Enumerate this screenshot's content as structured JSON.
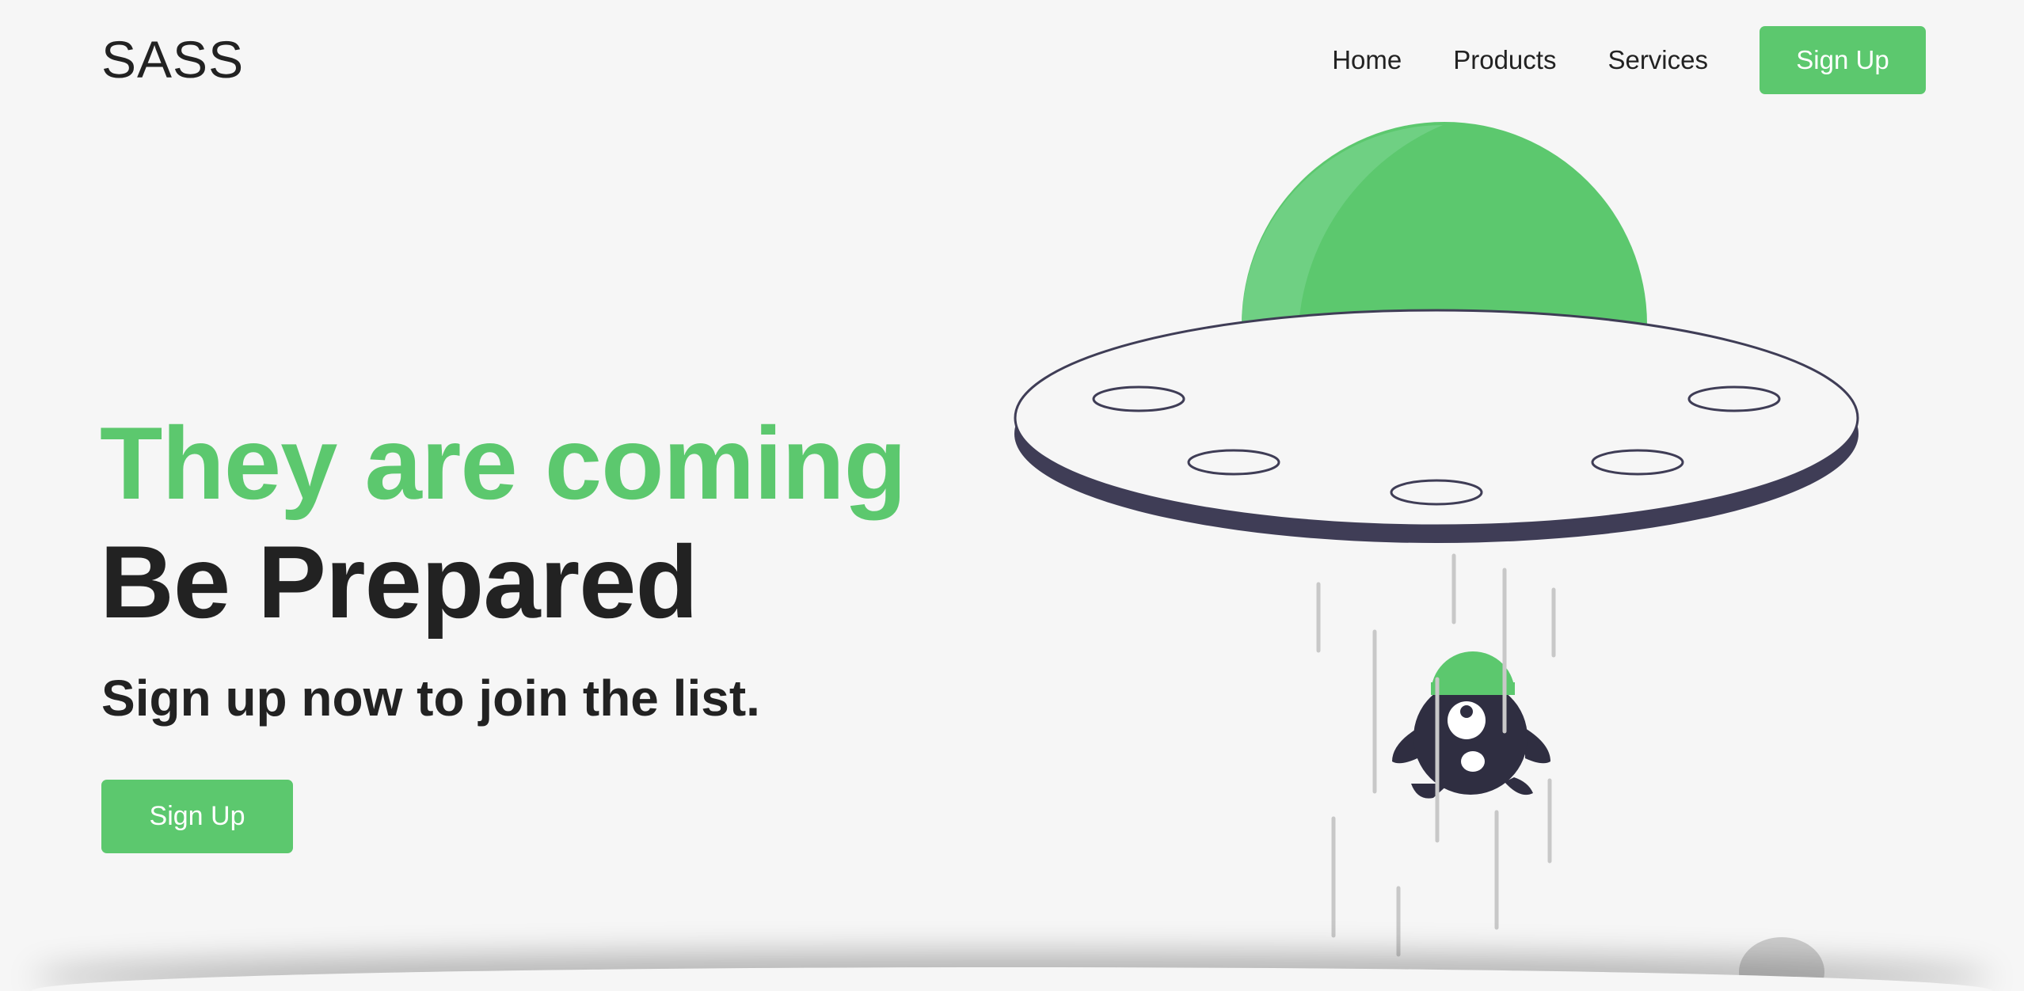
{
  "header": {
    "logo": "SASS",
    "nav": [
      "Home",
      "Products",
      "Services"
    ],
    "signup_label": "Sign Up"
  },
  "hero": {
    "title_line1": "They are coming",
    "title_line2": "Be Prepared",
    "subtitle": "Sign up now to join the list.",
    "signup_label": "Sign Up"
  },
  "colors": {
    "accent": "#5cc86e",
    "dark": "#222222",
    "ufo_rim": "#3f3d56",
    "background": "#f6f6f6"
  },
  "illustration": {
    "icon": "ufo-abducting-alien-illustration"
  }
}
